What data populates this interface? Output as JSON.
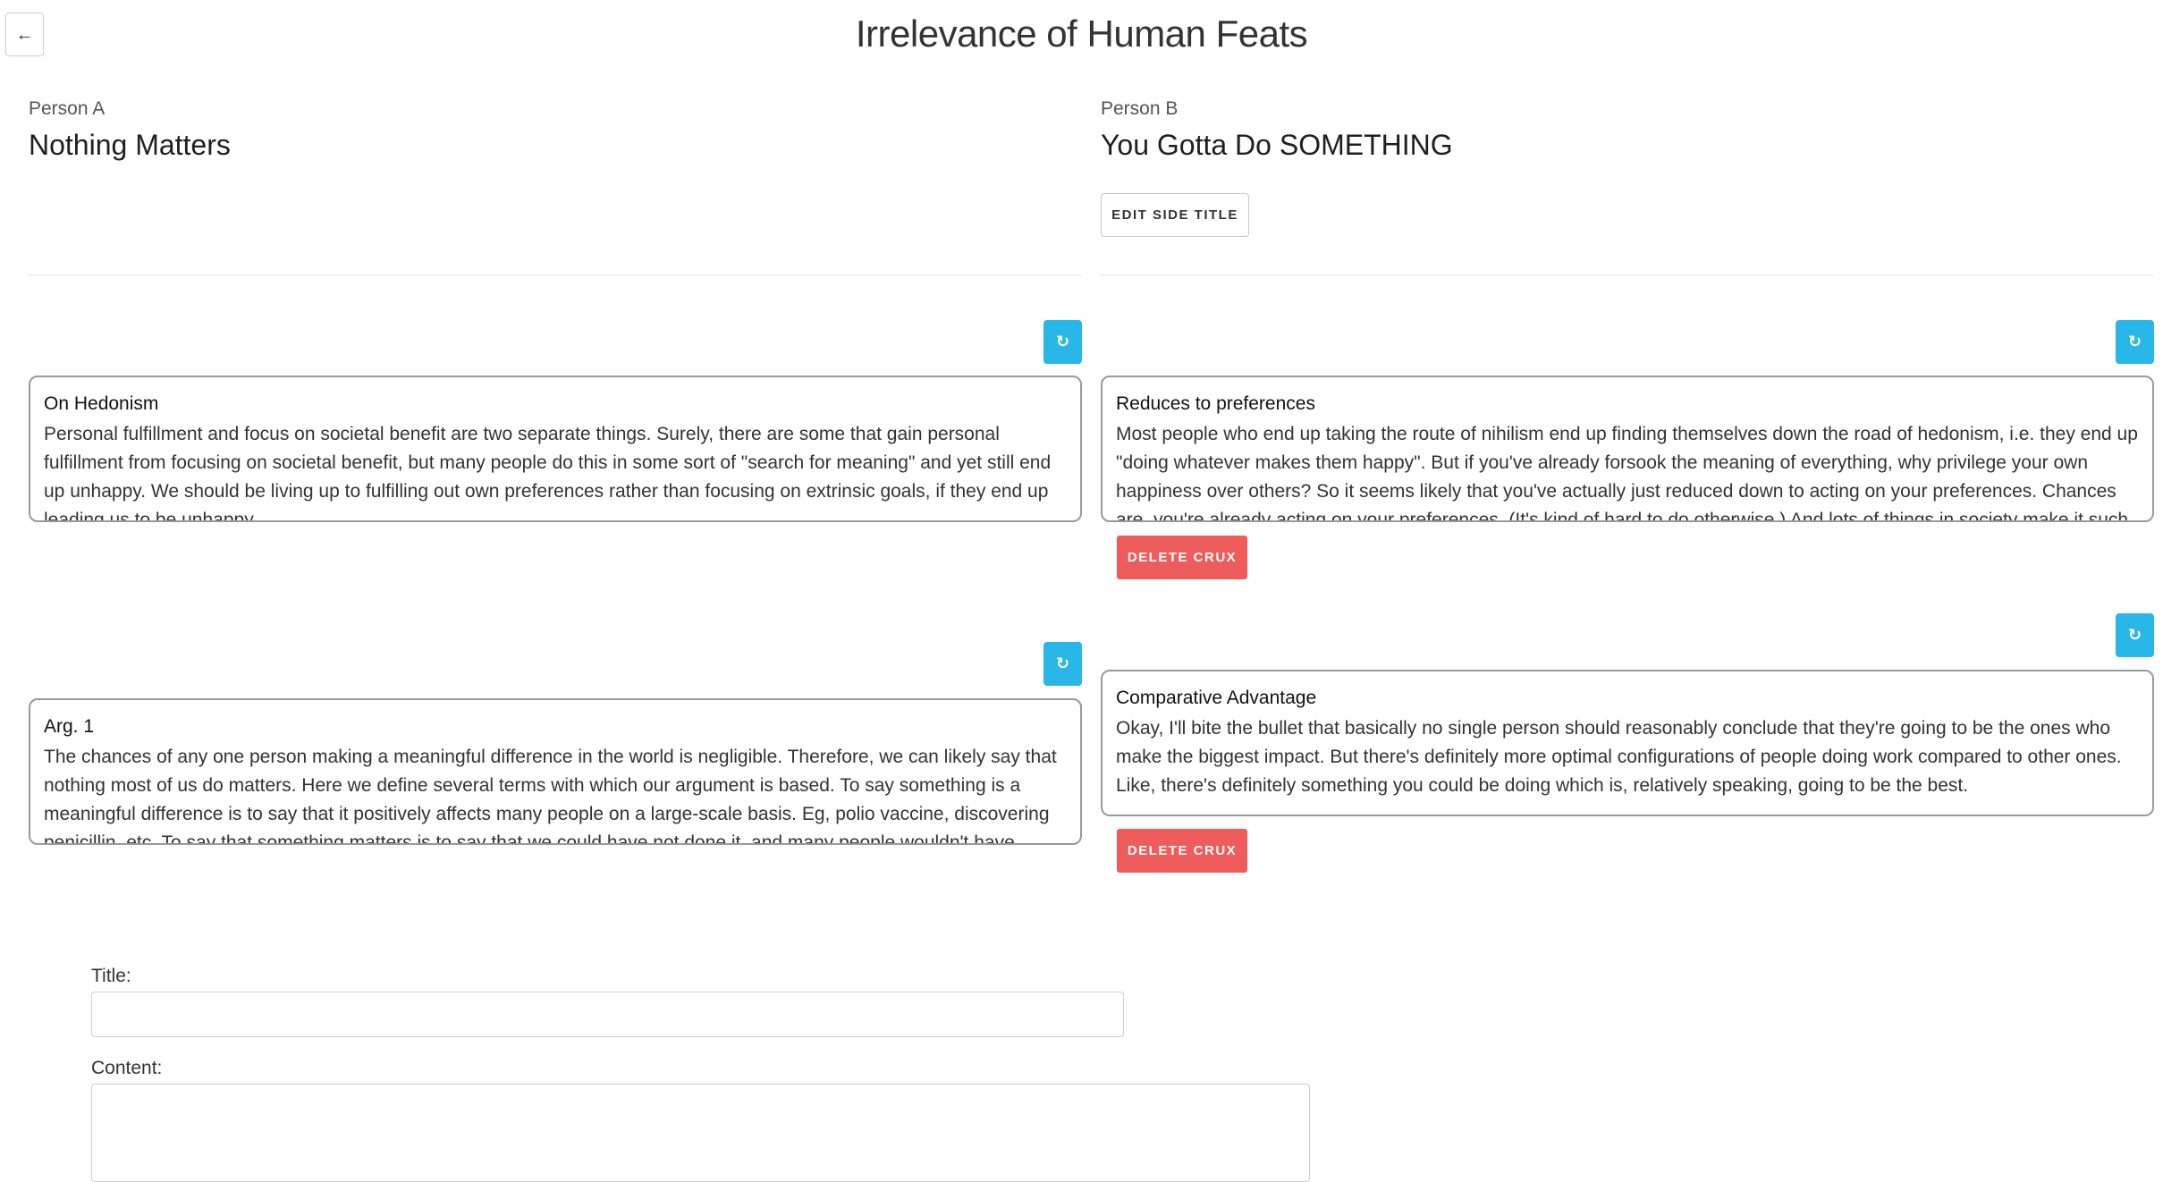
{
  "header": {
    "back_label": "←",
    "title": "Irrelevance of Human Feats"
  },
  "side_a": {
    "label": "Person A",
    "title": "Nothing Matters"
  },
  "side_b": {
    "label": "Person B",
    "title": "You Gotta Do SOMETHING",
    "edit_label": "EDIT SIDE TITLE"
  },
  "refresh_icon": "↻",
  "cards": {
    "a1": {
      "title": "On Hedonism",
      "body": "Personal fulfillment and focus on societal benefit are two separate things. Surely, there are some that gain personal fulfillment from focusing on societal benefit, but many people do this in some sort of \"search for meaning\" and yet still end up unhappy. We should be living up to fulfilling out own preferences rather than focusing on extrinsic goals, if they end up leading us to be unhappy."
    },
    "a2": {
      "title": "Arg. 1",
      "body": "The chances of any one person making a meaningful difference in the world is negligible. Therefore, we can likely say that nothing most of us do matters. Here we define several terms with which our argument is based. To say something is a meaningful difference is to say that it positively affects many people on a large-scale basis. Eg, polio vaccine, discovering penicillin, etc. To say that something matters is to say that we could have not done it, and many people wouldn't have"
    },
    "b1": {
      "title": "Reduces to preferences",
      "body": "Most people who end up taking the route of nihilism end up finding themselves down the road of hedonism, i.e. they end up \"doing whatever makes them happy\". But if you've already forsook the meaning of everything, why privilege your own happiness over others? So it seems likely that you've actually just reduced down to acting on your preferences. Chances are, you're already acting on your preferences. (It's kind of hard to do otherwise.) And lots of things in society make it such that"
    },
    "b2": {
      "title": "Comparative Advantage",
      "body": "Okay, I'll bite the bullet that basically no single person should reasonably conclude that they're going to be the ones who make the biggest impact. But there's definitely more optimal configurations of people doing work compared to other ones. Like, there's definitely something you could be doing which is, relatively speaking, going to be the best."
    }
  },
  "delete_label": "DELETE CRUX",
  "form": {
    "title_label": "Title:",
    "title_value": "",
    "content_label": "Content:",
    "content_value": ""
  }
}
